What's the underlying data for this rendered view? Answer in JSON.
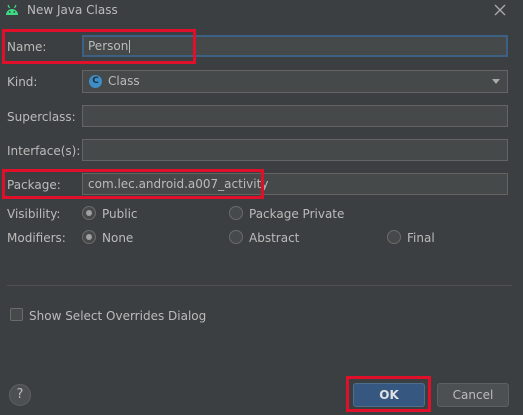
{
  "window": {
    "title": "New Java Class",
    "app_icon": "android-icon",
    "close_icon": "close-icon"
  },
  "form": {
    "name_label": "Name:",
    "name_value": "Person",
    "kind_label": "Kind:",
    "kind_value": "Class",
    "kind_icon": "class-icon",
    "kind_icon_glyph": "C",
    "superclass_label": "Superclass:",
    "superclass_value": "",
    "interfaces_label": "Interface(s):",
    "interfaces_value": "",
    "package_label": "Package:",
    "package_value": "com.lec.android.a007_activity",
    "visibility_label": "Visibility:",
    "visibility_options": [
      {
        "label": "Public",
        "selected": true
      },
      {
        "label": "Package Private",
        "selected": false
      }
    ],
    "modifiers_label": "Modifiers:",
    "modifier_options": [
      {
        "label": "None",
        "selected": true
      },
      {
        "label": "Abstract",
        "selected": false
      },
      {
        "label": "Final",
        "selected": false
      }
    ],
    "overrides_checkbox_label": "Show Select Overrides Dialog",
    "overrides_checked": false
  },
  "footer": {
    "help_label": "?",
    "ok_label": "OK",
    "cancel_label": "Cancel"
  },
  "colors": {
    "background": "#3c3f41",
    "field_bg": "#45494a",
    "focus_border": "#3d6185",
    "ok_button": "#365880",
    "annotation_red": "#e0102b",
    "android_green": "#3ddc84"
  }
}
